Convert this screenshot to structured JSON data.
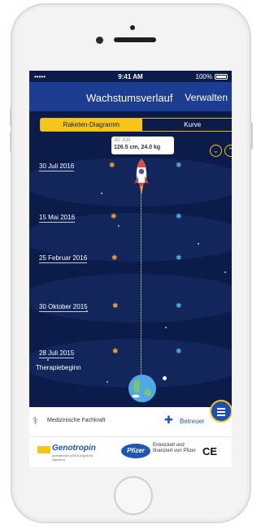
{
  "status": {
    "signal": "••••• ",
    "time": "9:41 AM",
    "battery": "100%"
  },
  "nav": {
    "title": "Wachstumsverlauf",
    "action": "Verwalten"
  },
  "tabs": [
    {
      "label": "Raketen-Diagramm",
      "active": true
    },
    {
      "label": "Kurve",
      "active": false
    }
  ],
  "tooltip": {
    "date": "30 Juli",
    "value": "126.5 cm, 24.0 kg"
  },
  "scroll_buttons": {
    "down": "⌄",
    "up": "⌃"
  },
  "timeline": [
    {
      "date": "30 Juli 2016"
    },
    {
      "date": "15 Mai 2016"
    },
    {
      "date": "25 Februar 2016"
    },
    {
      "date": "30 Oktober 2015"
    },
    {
      "date": "28 Juli 2015",
      "note": "Therapiebeginn"
    }
  ],
  "bottom": {
    "left_label": "Medizinische Fachkraft",
    "right_label": "Betreuer"
  },
  "footer": {
    "brand": "Genotropin",
    "brand_sub": "(somatropin [rDNA origin] for injection)",
    "partner": "Pfizer",
    "developed": "Entwickelt und finanziert von Pfizer",
    "ce": "CE"
  },
  "colors": {
    "nav": "#1c3d92",
    "background": "#0c1c4a",
    "accent": "#f5c518"
  }
}
